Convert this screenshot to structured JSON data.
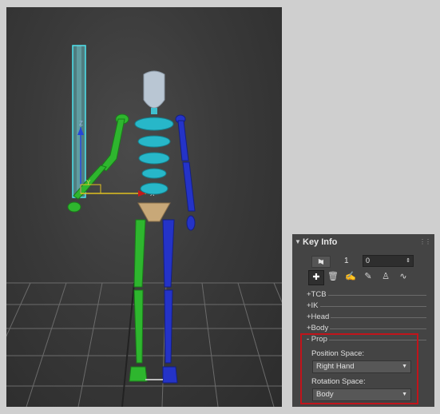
{
  "panel": {
    "title": "Key Info",
    "key_number": "1",
    "time_value": "0",
    "spinner_arrows": "⇕",
    "nav_prev": "◆",
    "nav_next": "◆",
    "tools": [
      "set-key-icon",
      "delete-key-icon",
      "set-planted-key-icon",
      "set-sliding-key-icon",
      "set-free-key-icon",
      "curve-icon"
    ],
    "collapsed_sections": [
      "+TCB",
      "+IK",
      "+Head",
      "+Body"
    ],
    "expanded_section": "- Prop",
    "position_space_label": "Position Space:",
    "position_space_value": "Right Hand",
    "rotation_space_label": "Rotation Space:",
    "rotation_space_value": "Body",
    "dropdown_arrow": "▼",
    "rollout_arrow": "▼",
    "grip": "⋮⋮"
  },
  "viewport": {
    "gizmo_labels": [
      "Z",
      "Y",
      "X"
    ]
  }
}
